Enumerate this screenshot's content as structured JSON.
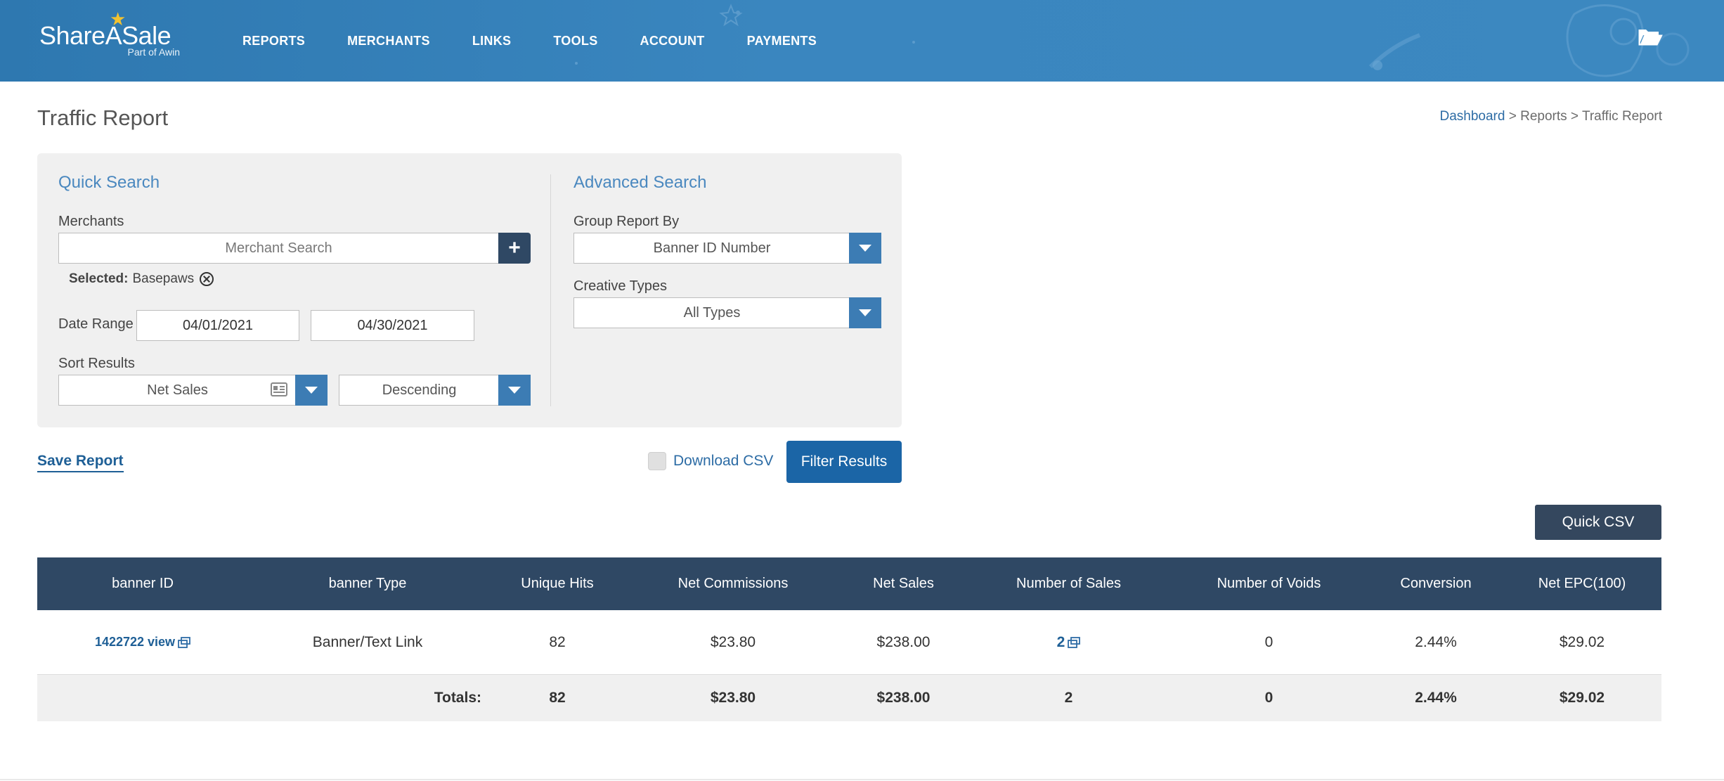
{
  "brand": {
    "name": "ShareASale",
    "tagline": "Part of Awin",
    "header_color": "#3a86bf",
    "accent_star": "#f2c230"
  },
  "nav": {
    "items": [
      "REPORTS",
      "MERCHANTS",
      "LINKS",
      "TOOLS",
      "ACCOUNT",
      "PAYMENTS"
    ],
    "folder_icon": "folder-open-icon"
  },
  "page": {
    "title": "Traffic Report",
    "breadcrumb": {
      "home": "Dashboard",
      "sep1": " > ",
      "middle": "Reports",
      "sep2": " > ",
      "current": "Traffic Report"
    }
  },
  "quick_search": {
    "title": "Quick Search",
    "merchants_label": "Merchants",
    "merchant_placeholder": "Merchant Search",
    "selected_label": "Selected:",
    "selected_value": "Basepaws",
    "date_range_label": "Date Range",
    "date_from": "04/01/2021",
    "date_to": "04/30/2021",
    "sort_label": "Sort Results",
    "sort_by": "Net Sales",
    "sort_order": "Descending"
  },
  "advanced_search": {
    "title": "Advanced Search",
    "group_label": "Group Report By",
    "group_value": "Banner ID Number",
    "creative_label": "Creative Types",
    "creative_value": "All Types"
  },
  "actions": {
    "save_report": "Save Report",
    "download_csv": "Download CSV",
    "filter_results": "Filter Results",
    "quick_csv": "Quick CSV"
  },
  "table": {
    "headers": [
      "banner ID",
      "banner Type",
      "Unique Hits",
      "Net Commissions",
      "Net Sales",
      "Number of Sales",
      "Number of Voids",
      "Conversion",
      "Net EPC(100)"
    ],
    "rows": [
      {
        "banner_id": "1422722 view",
        "banner_type": "Banner/Text Link",
        "unique_hits": "82",
        "net_commissions": "$23.80",
        "net_sales": "$238.00",
        "number_of_sales": "2",
        "number_of_voids": "0",
        "conversion": "2.44%",
        "net_epc": "$29.02"
      }
    ],
    "totals": {
      "label": "Totals:",
      "unique_hits": "82",
      "net_commissions": "$23.80",
      "net_sales": "$238.00",
      "number_of_sales": "2",
      "number_of_voids": "0",
      "conversion": "2.44%",
      "net_epc": "$29.02"
    }
  }
}
